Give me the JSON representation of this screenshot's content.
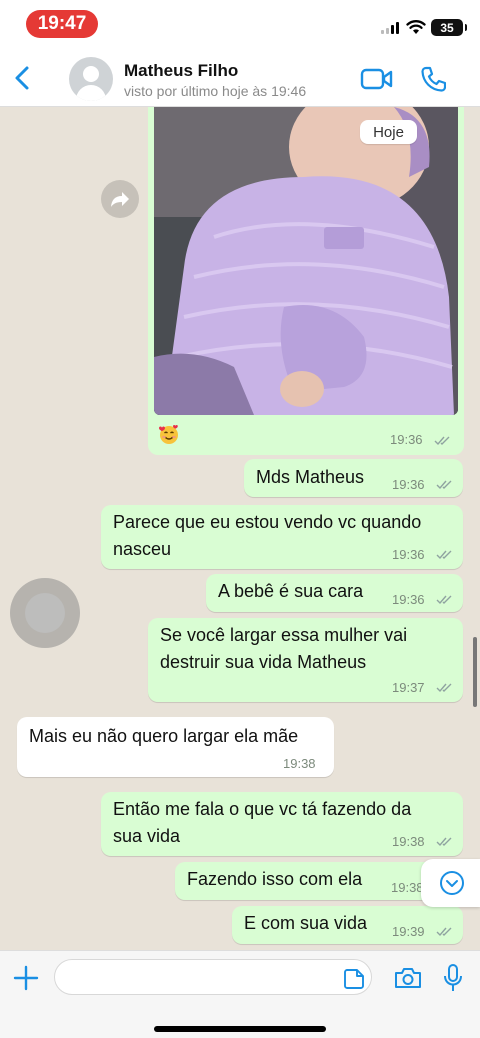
{
  "status_bar": {
    "time": "19:47",
    "battery": "35"
  },
  "header": {
    "contact_name": "Matheus Filho",
    "contact_status": "visto por último hoje às 19:46"
  },
  "chat": {
    "date_chip": "Hoje",
    "image_message": {
      "caption_emoji": "🥰",
      "time": "19:36"
    },
    "messages": [
      {
        "side": "out",
        "lines": [
          "Mds Matheus"
        ],
        "time": "19:36"
      },
      {
        "side": "out",
        "lines": [
          "Parece que eu estou vendo vc quando",
          "nasceu"
        ],
        "time": "19:36"
      },
      {
        "side": "out",
        "lines": [
          "A bebê é sua cara"
        ],
        "time": "19:36"
      },
      {
        "side": "out",
        "lines": [
          "Se você largar essa mulher vai",
          "destruir sua vida Matheus"
        ],
        "time": "19:37"
      },
      {
        "side": "in",
        "lines": [
          "Mais eu não quero largar ela mãe"
        ],
        "time": "19:38"
      },
      {
        "side": "out",
        "lines": [
          "Então me fala o que vc tá fazendo da",
          "sua vida"
        ],
        "time": "19:38"
      },
      {
        "side": "out",
        "lines": [
          "Fazendo isso com ela"
        ],
        "time": "19:38"
      },
      {
        "side": "out",
        "lines": [
          "E com sua vida"
        ],
        "time": "19:39"
      }
    ]
  },
  "colors": {
    "outgoing_bubble": "#d9fdd3",
    "incoming_bubble": "#ffffff",
    "accent": "#1a8fe3",
    "chat_bg": "#e8e2d8",
    "status_pill": "#e53935"
  }
}
